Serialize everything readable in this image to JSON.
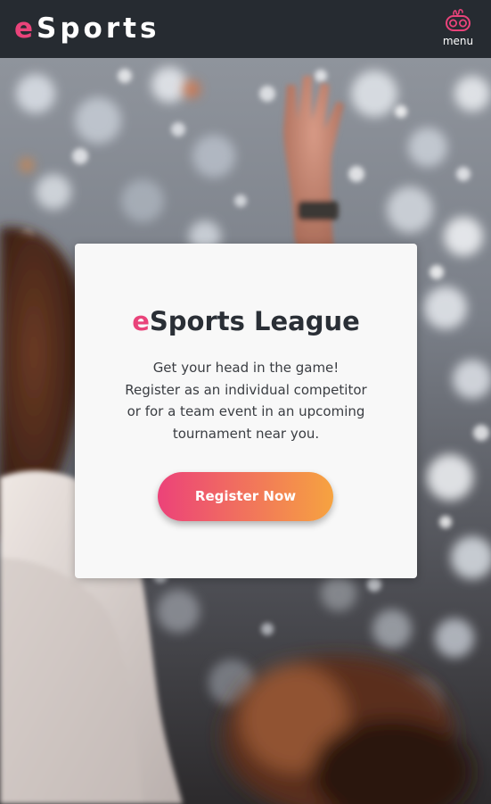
{
  "header": {
    "logo_accent": "e",
    "logo_rest": "Sports",
    "menu_label": "menu",
    "menu_icon": "gamepad-icon",
    "background": "#262b31"
  },
  "hero": {
    "image": "concert-crowd-photo"
  },
  "card": {
    "title_accent": "e",
    "title_rest": "Sports League",
    "body": "Get your head in the game! Register as an individual competitor or for a team event in an upcoming tournament near you.",
    "cta_label": "Register Now"
  },
  "colors": {
    "accent_pink": "#e9437a",
    "accent_orange": "#f6a340",
    "card_bg": "#f8f8f8",
    "text_dark": "#2a2f36"
  }
}
